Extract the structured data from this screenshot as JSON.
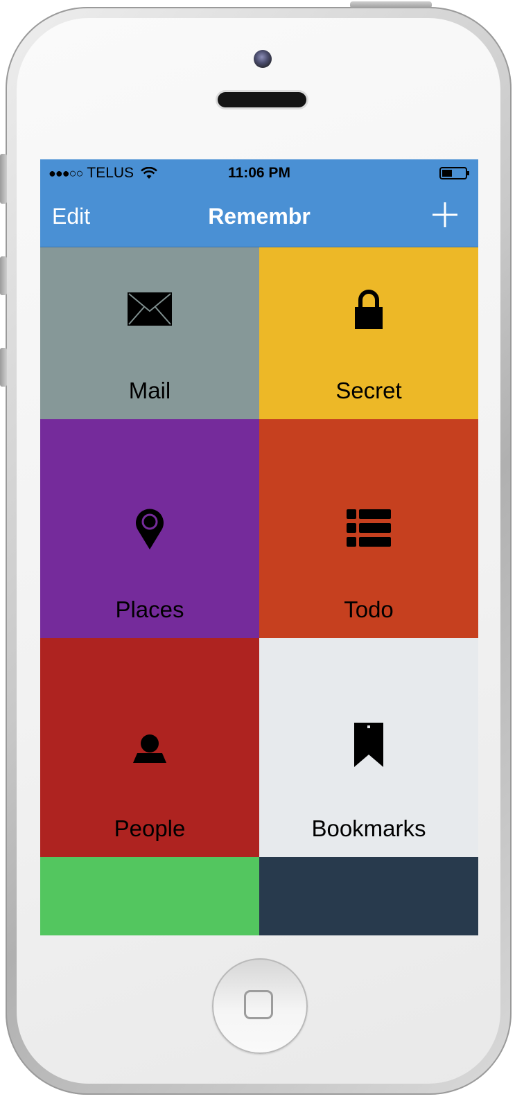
{
  "status_bar": {
    "signal": "●●●○○",
    "carrier": "TELUS",
    "time": "11:06 PM"
  },
  "nav": {
    "edit_label": "Edit",
    "title": "Remembr",
    "add_icon": "plus-icon"
  },
  "tiles": [
    {
      "label": "Mail",
      "icon": "envelope-icon",
      "color": "#869898"
    },
    {
      "label": "Secret",
      "icon": "lock-icon",
      "color": "#edb827"
    },
    {
      "label": "Places",
      "icon": "map-pin-icon",
      "color": "#752b9b"
    },
    {
      "label": "Todo",
      "icon": "list-icon",
      "color": "#c6401f"
    },
    {
      "label": "People",
      "icon": "person-icon",
      "color": "#ae2320"
    },
    {
      "label": "Bookmarks",
      "icon": "bookmark-icon",
      "color": "#e7eaed"
    },
    {
      "label": "",
      "icon": "",
      "color": "#53c65f"
    },
    {
      "label": "",
      "icon": "",
      "color": "#283a4d"
    }
  ],
  "colors": {
    "nav_blue": "#4a90d4"
  }
}
